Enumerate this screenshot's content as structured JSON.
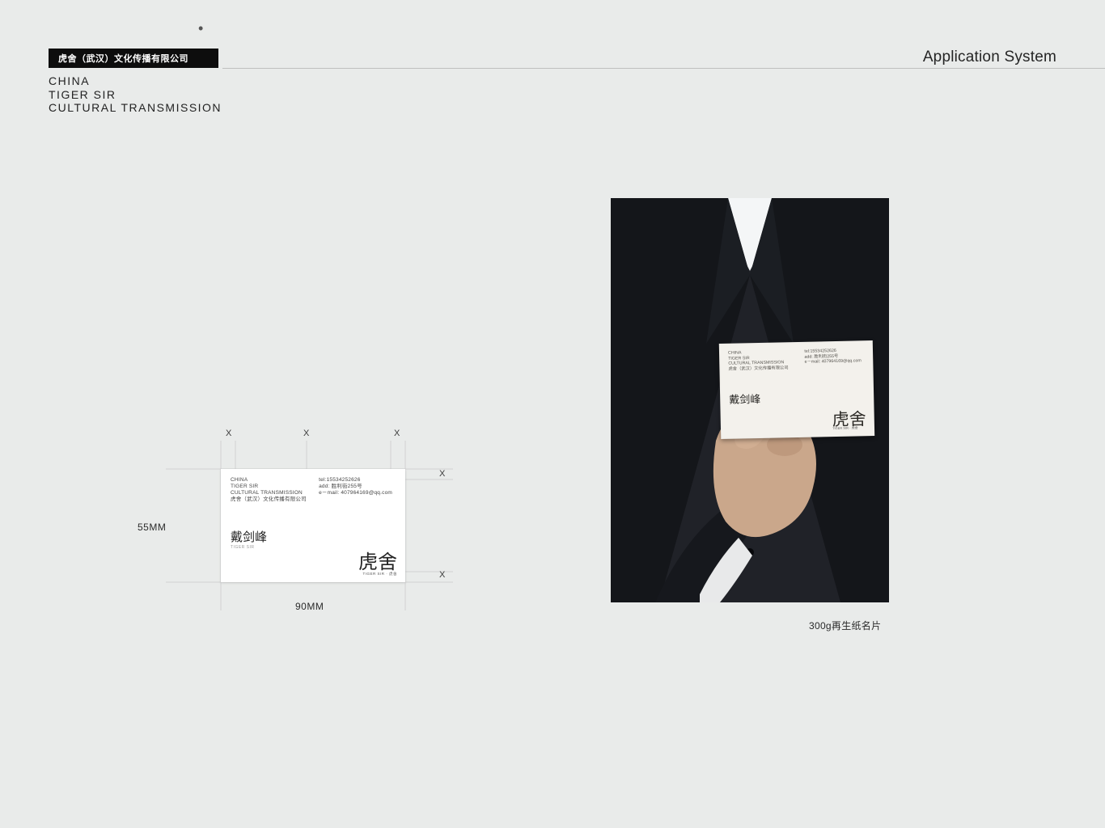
{
  "header": {
    "company_cn": "虎舍（武汉）文化传播有限公司",
    "eng_line1": "CHINA",
    "eng_line2": "TIGER SIR",
    "eng_line3": "CULTURAL TRANSMISSION",
    "title_right": "Application System",
    "bullet": "•"
  },
  "spec": {
    "height_label": "55MM",
    "width_label": "90MM",
    "x": "X"
  },
  "card": {
    "eng_line1": "CHINA",
    "eng_line2": "TIGER SIR",
    "eng_line3": "CULTURAL TRANSMISSION",
    "company_cn": "虎舍（武汉）文化传播有限公司",
    "tel": "tel:15534252626",
    "add": "add: 胜利街255号",
    "email": "e－mail: 407964169@qq.com",
    "name": "戴剑峰",
    "name_sub": "TIGER SIR",
    "logo_text": "虎舍",
    "logo_sub": "TIGER SIR · 虎舍"
  },
  "mockup": {
    "caption": "300g再生纸名片"
  }
}
